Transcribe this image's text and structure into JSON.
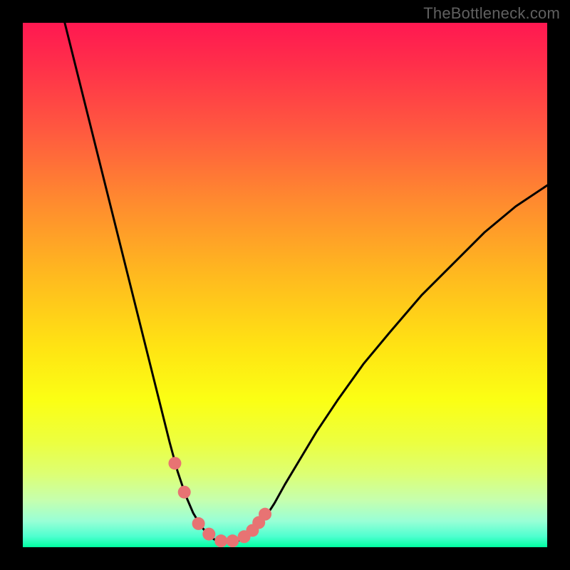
{
  "watermark": "TheBottleneck.com",
  "chart_data": {
    "type": "line",
    "title": "",
    "xlabel": "",
    "ylabel": "",
    "xlim": [
      0,
      100
    ],
    "ylim": [
      0,
      100
    ],
    "grid": false,
    "series": [
      {
        "name": "left-arm",
        "x": [
          8,
          10,
          12,
          14,
          16,
          18,
          20,
          22,
          24,
          26,
          28,
          29.5,
          31,
          32.5,
          34,
          35,
          36,
          37
        ],
        "y": [
          100,
          92,
          84,
          76,
          68,
          60,
          52,
          44,
          36,
          28,
          20,
          14.5,
          10,
          6.5,
          4,
          2.8,
          1.8,
          1.2
        ]
      },
      {
        "name": "right-arm",
        "x": [
          41,
          42,
          43,
          44.5,
          46,
          48,
          50,
          53,
          56,
          60,
          65,
          70,
          76,
          82,
          88,
          94,
          100
        ],
        "y": [
          1.2,
          1.6,
          2.3,
          3.6,
          5.3,
          8.4,
          12,
          17,
          22,
          28,
          35,
          41,
          48,
          54,
          60,
          65,
          69
        ]
      },
      {
        "name": "floor",
        "x": [
          37,
          38.5,
          40,
          41
        ],
        "y": [
          1.2,
          0.9,
          0.9,
          1.2
        ]
      }
    ],
    "markers": [
      {
        "name": "left-dot-1",
        "x": 29.0,
        "y": 16.0
      },
      {
        "name": "left-dot-2",
        "x": 30.8,
        "y": 10.5
      },
      {
        "name": "floor-dot-1",
        "x": 33.5,
        "y": 4.5
      },
      {
        "name": "floor-dot-2",
        "x": 35.5,
        "y": 2.5
      },
      {
        "name": "floor-dot-3",
        "x": 37.8,
        "y": 1.2
      },
      {
        "name": "floor-dot-4",
        "x": 40.0,
        "y": 1.2
      },
      {
        "name": "right-dot-1",
        "x": 42.2,
        "y": 2.0
      },
      {
        "name": "right-dot-2",
        "x": 43.8,
        "y": 3.2
      },
      {
        "name": "right-dot-3",
        "x": 45.0,
        "y": 4.7
      },
      {
        "name": "right-dot-4",
        "x": 46.2,
        "y": 6.3
      }
    ],
    "marker_color": "#e87373",
    "curve_color": "#000000"
  }
}
